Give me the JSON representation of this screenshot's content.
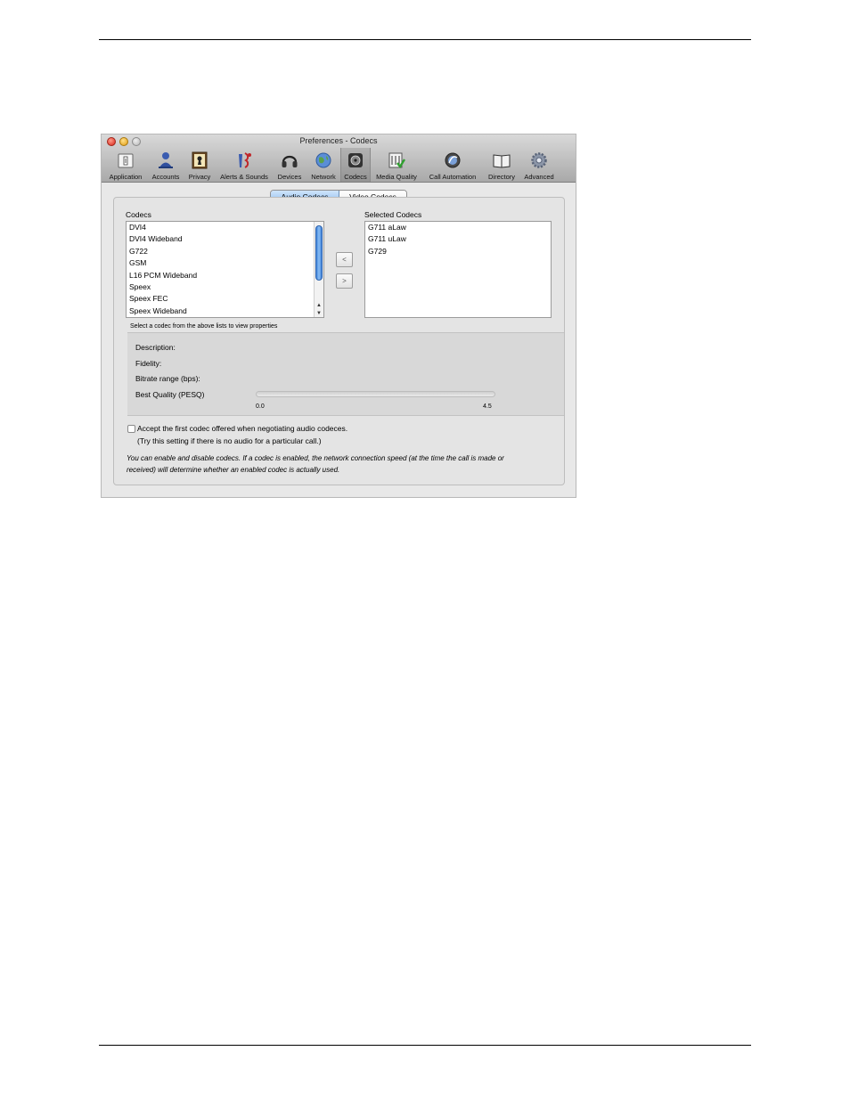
{
  "window": {
    "title": "Preferences - Codecs"
  },
  "toolbar": {
    "items": [
      {
        "label": "Application",
        "icon": "application-icon"
      },
      {
        "label": "Accounts",
        "icon": "accounts-icon"
      },
      {
        "label": "Privacy",
        "icon": "privacy-icon"
      },
      {
        "label": "Alerts & Sounds",
        "icon": "alerts-sounds-icon"
      },
      {
        "label": "Devices",
        "icon": "headset-icon"
      },
      {
        "label": "Network",
        "icon": "network-globe-icon"
      },
      {
        "label": "Codecs",
        "icon": "codecs-icon",
        "active": true
      },
      {
        "label": "Media Quality",
        "icon": "media-quality-icon"
      },
      {
        "label": "Call Automation",
        "icon": "call-automation-icon"
      },
      {
        "label": "Directory",
        "icon": "directory-book-icon"
      },
      {
        "label": "Advanced",
        "icon": "advanced-gear-icon"
      }
    ]
  },
  "tabs": {
    "audio": "Audio Codecs",
    "video": "Video Codecs",
    "selected": "audio"
  },
  "codecs": {
    "label": "Codecs",
    "items": [
      "DVI4",
      "DVI4 Wideband",
      "G722",
      "GSM",
      "L16 PCM Wideband",
      "Speex",
      "Speex FEC",
      "Speex Wideband"
    ]
  },
  "selected_codecs": {
    "label": "Selected Codecs",
    "items": [
      "G711 aLaw",
      "G711 uLaw",
      "G729"
    ]
  },
  "buttons": {
    "remove": "<",
    "add": ">"
  },
  "properties": {
    "hint": "Select a codec from the above lists to view properties",
    "description_label": "Description:",
    "fidelity_label": "Fidelity:",
    "bitrate_label": "Bitrate range (bps):",
    "pesq_label": "Best Quality (PESQ)",
    "pesq_min": "0.0",
    "pesq_max": "4.5",
    "pesq_value": 0
  },
  "option": {
    "checked": false,
    "line1": "Accept the first codec offered when negotiating audio codeces.",
    "line2": "(Try this setting if there is no audio for a particular call.)"
  },
  "footer_note": {
    "line1": "You can enable and disable codecs. If a codec is enabled, the network connection speed (at the time the call is made or",
    "line2": "received) will determine whether an enabled codec is actually used."
  },
  "colors": {
    "accent": "#3d7fd8",
    "tab_selected": "#8dbdef"
  }
}
